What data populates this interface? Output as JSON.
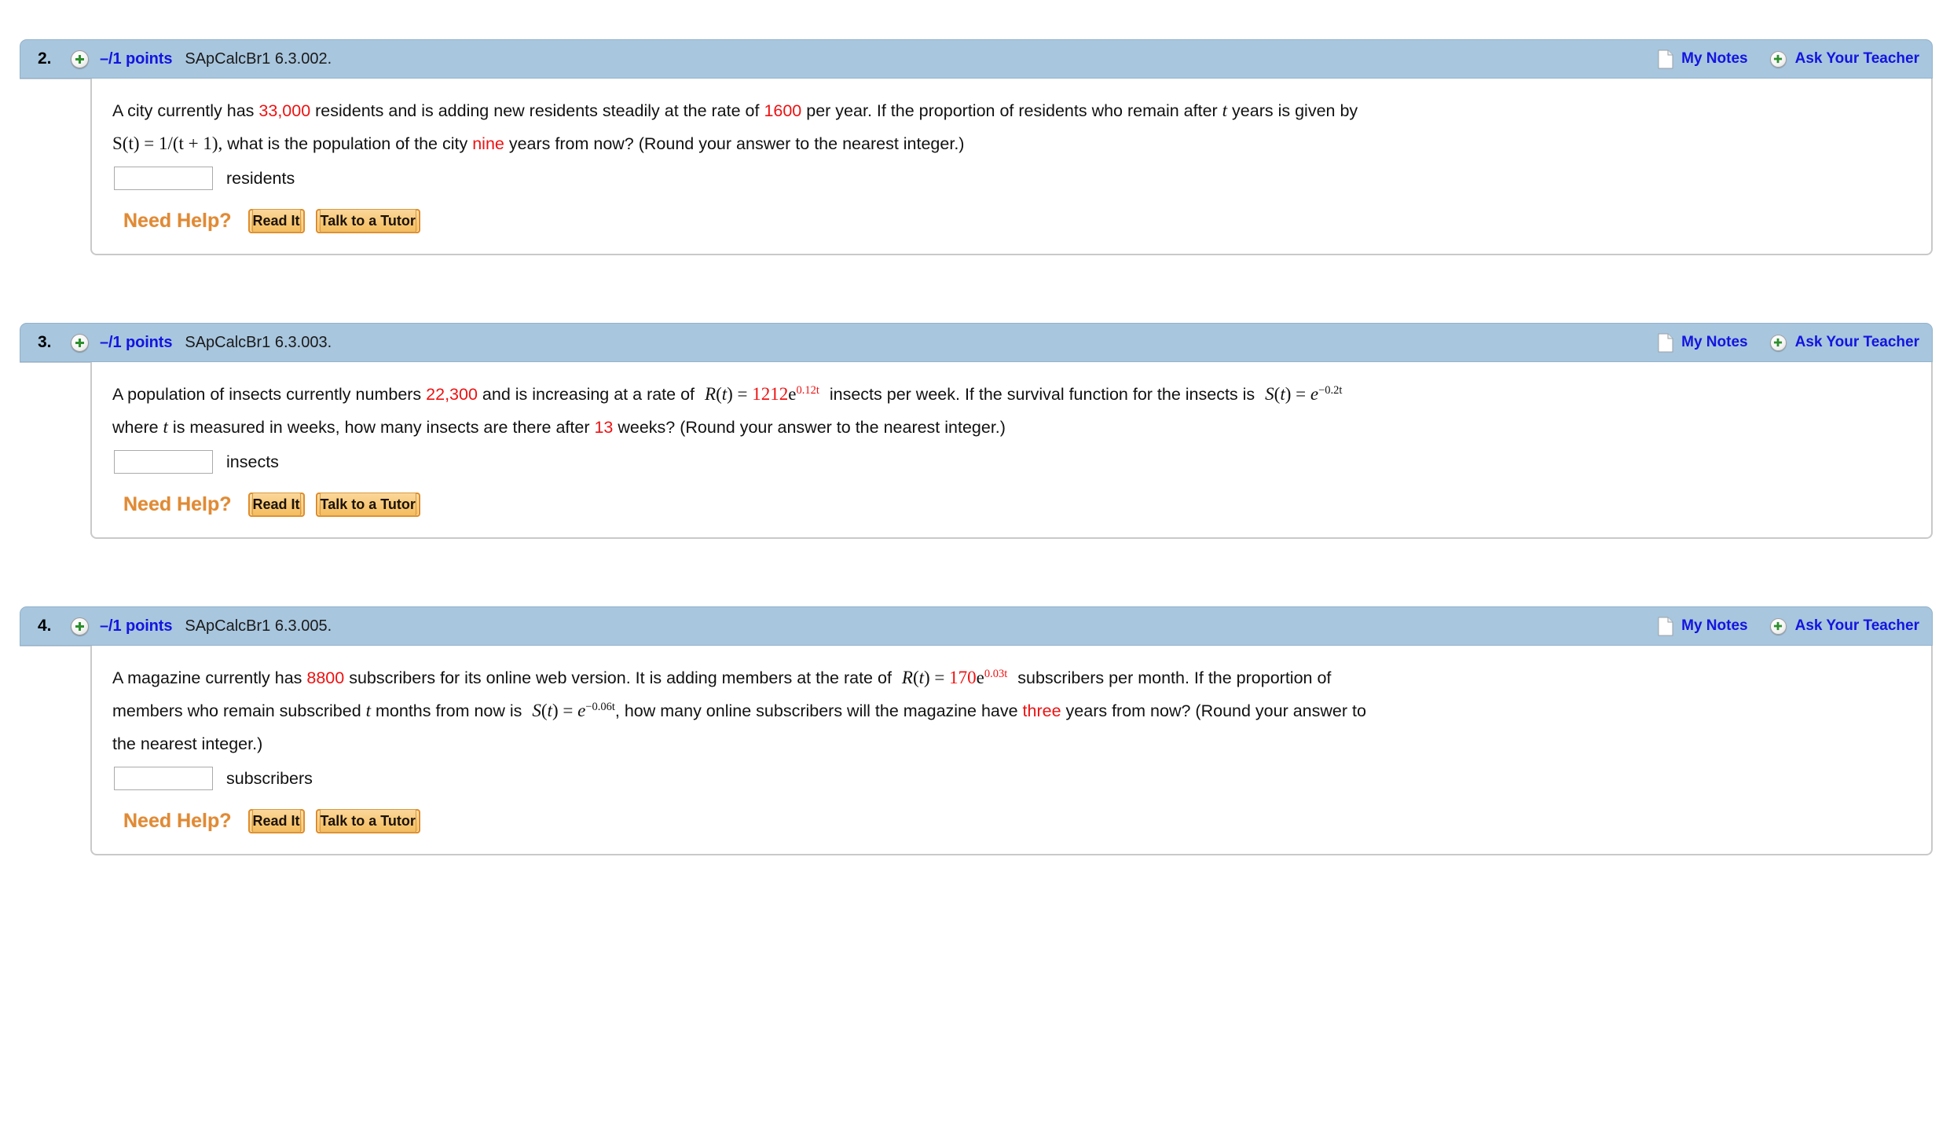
{
  "meta": {
    "accent_header_bg": "#a8c6de",
    "link_blue": "#1414e0",
    "highlight_red": "#ee1111",
    "need_help_orange": "#e08a35",
    "button_orange": "#e08b28"
  },
  "labels": {
    "my_notes": "My Notes",
    "ask_your_teacher": "Ask Your Teacher",
    "need_help": "Need Help?",
    "read_it": "Read It",
    "talk_to_a_tutor": "Talk to a Tutor",
    "notes_icon": "note-page-icon",
    "plus_icon": "plus-circle-icon"
  },
  "questions": [
    {
      "number": "2.",
      "points": "–/1 points",
      "code": "SApCalcBr1 6.3.002.",
      "answer_value": "",
      "answer_placeholder": "",
      "unit": "residents",
      "text": {
        "p1": "A city currently has ",
        "v1": "33,000",
        "p2": " residents and is adding new residents steadily at the rate of ",
        "v2": "1600",
        "p3": " per year. If the proportion of residents who remain after ",
        "var1": "t",
        "p4": " years is given by",
        "formula": "S(t) = 1/(t + 1),",
        "p5": " what is the population of the city ",
        "v3": "nine",
        "p6": " years from now? (Round your answer to the nearest integer.)"
      }
    },
    {
      "number": "3.",
      "points": "–/1 points",
      "code": "SApCalcBr1 6.3.003.",
      "answer_value": "",
      "answer_placeholder": "",
      "unit": "insects",
      "text": {
        "p1": "A population of insects currently numbers ",
        "v1": "22,300",
        "p2": " and is increasing at a rate of ",
        "fn1": "R(t) = ",
        "coef1": "1212",
        "base1": "e",
        "exp1": "0.12t",
        "p3": " insects per week. If the survival function for the insects is ",
        "fn2": "S(t) = ",
        "base2": "e",
        "exp2": "−0.2t",
        "p4": "where ",
        "var1": "t",
        "p5": " is measured in weeks, how many insects are there after ",
        "v2": "13",
        "p6": " weeks? (Round your answer to the nearest integer.)"
      }
    },
    {
      "number": "4.",
      "points": "–/1 points",
      "code": "SApCalcBr1 6.3.005.",
      "answer_value": "",
      "answer_placeholder": "",
      "unit": "subscribers",
      "text": {
        "p1": "A magazine currently has ",
        "v1": "8800",
        "p2": " subscribers for its online web version. It is adding members at the rate of ",
        "fn1": "R(t) = ",
        "coef1": "170",
        "base1": "e",
        "exp1": "0.03t",
        "p3": " subscribers per month. If the proportion of",
        "p4": "members who remain subscribed ",
        "var1": "t",
        "p5": " months from now is ",
        "fn2": "S(t) = ",
        "base2": "e",
        "exp2": "−0.06t",
        "p6": ", how many online subscribers will the magazine have ",
        "v2": "three",
        "p7": " years from now? (Round your answer to",
        "p8": "the nearest integer.)"
      }
    }
  ]
}
